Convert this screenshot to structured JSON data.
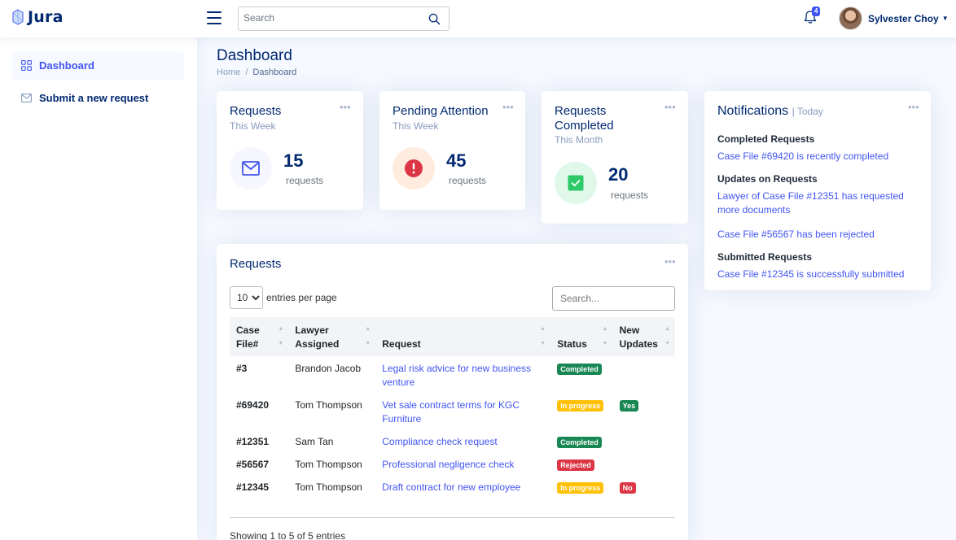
{
  "header": {
    "brand": "Jura",
    "search_placeholder": "Search",
    "notification_count": "4",
    "user_name": "Sylvester Choy"
  },
  "sidebar": {
    "items": [
      {
        "label": "Dashboard",
        "icon": "grid-icon",
        "active": true
      },
      {
        "label": "Submit a new request",
        "icon": "envelope-icon",
        "active": false
      }
    ]
  },
  "page": {
    "title": "Dashboard",
    "breadcrumb": [
      "Home",
      "/",
      "Dashboard"
    ]
  },
  "stats": [
    {
      "title": "Requests",
      "subtitle": "This Week",
      "value": "15",
      "unit": "requests",
      "icon": "envelope-icon",
      "accent": "#4154f1",
      "bg": "#f6f6fe"
    },
    {
      "title": "Pending Attention",
      "subtitle": "This Week",
      "value": "45",
      "unit": "requests",
      "icon": "exclamation-circle-icon",
      "accent": "#dc3545",
      "bg": "#ffecdf"
    },
    {
      "title": "Requests Completed",
      "subtitle": "This Month",
      "value": "20",
      "unit": "requests",
      "icon": "check-square-icon",
      "accent": "#2eca6a",
      "bg": "#e0f8e9"
    }
  ],
  "notifications": {
    "title": "Notifications",
    "period": "| Today",
    "groups": [
      {
        "heading": "Completed Requests",
        "links": [
          "Case File #69420 is recently completed"
        ]
      },
      {
        "heading": "Updates on Requests",
        "links": [
          "Lawyer of Case File #12351 has requested more documents",
          "Case File #56567 has been rejected"
        ]
      },
      {
        "heading": "Submitted Requests",
        "links": [
          "Case File #12345 is successfully submitted"
        ]
      }
    ]
  },
  "requests_table": {
    "title": "Requests",
    "entries_value": "10",
    "entries_label": "entries per page",
    "search_placeholder": "Search...",
    "columns": [
      "Case File#",
      "Lawyer Assigned",
      "Request",
      "Status",
      "New Updates"
    ],
    "rows": [
      {
        "case": "#3",
        "lawyer": "Brandon Jacob",
        "request": "Legal risk advice for new business venture",
        "status": "Completed",
        "status_color": "#198754",
        "update": ""
      },
      {
        "case": "#69420",
        "lawyer": "Tom Thompson",
        "request": "Vet sale contract terms for KGC Furniture",
        "status": "In progress",
        "status_color": "#ffc107",
        "update": "Yes"
      },
      {
        "case": "#12351",
        "lawyer": "Sam Tan",
        "request": "Compliance check request",
        "status": "Completed",
        "status_color": "#198754",
        "update": ""
      },
      {
        "case": "#56567",
        "lawyer": "Tom Thompson",
        "request": "Professional negligence check",
        "status": "Rejected",
        "status_color": "#dc3545",
        "update": ""
      },
      {
        "case": "#12345",
        "lawyer": "Tom Thompson",
        "request": "Draft contract for new employee",
        "status": "In progress",
        "status_color": "#ffc107",
        "update": "No"
      }
    ],
    "footer": "Showing 1 to 5 of 5 entries"
  }
}
